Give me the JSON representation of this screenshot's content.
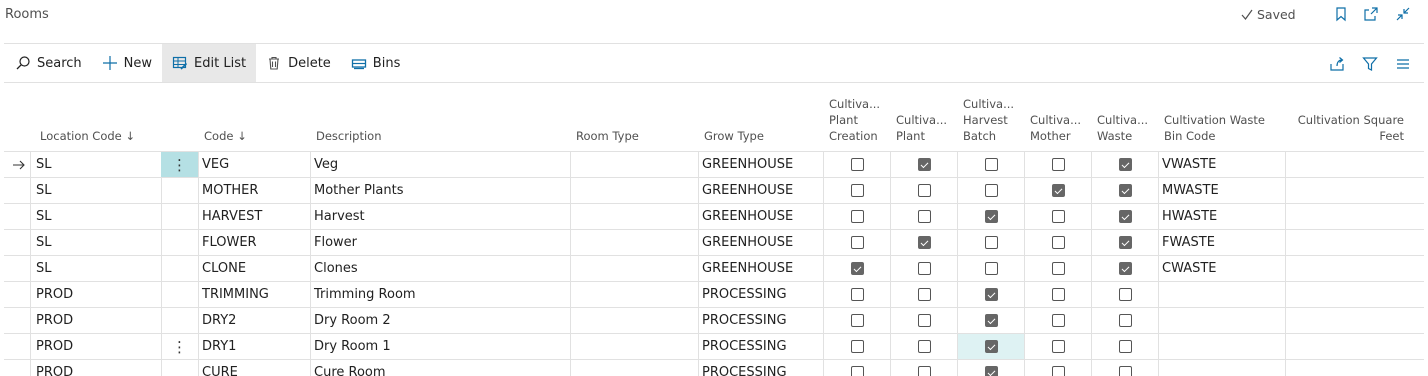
{
  "page": {
    "title": "Rooms",
    "saved_label": "Saved"
  },
  "toolbar": {
    "search": "Search",
    "new": "New",
    "edit_list": "Edit List",
    "delete": "Delete",
    "bins": "Bins"
  },
  "columns": {
    "location_code": "Location Code ↓",
    "code": "Code ↓",
    "description": "Description",
    "room_type": "Room Type",
    "grow_type": "Grow Type",
    "plant_creation": "Cultiva... Plant Creation",
    "plant": "Cultiva... Plant",
    "harvest_batch": "Cultiva... Harvest Batch",
    "mother": "Cultiva... Mother",
    "waste": "Cultiva... Waste",
    "waste_bin_code": "Cultivation Waste Bin Code",
    "square_feet": "Cultivation Square Feet"
  },
  "rows": [
    {
      "location": "SL",
      "code": "VEG",
      "description": "Veg",
      "room_type": "",
      "grow_type": "GREENHOUSE",
      "plant_creation": false,
      "plant": true,
      "harvest_batch": false,
      "mother": false,
      "waste": true,
      "waste_bin": "VWASTE",
      "square_feet": ""
    },
    {
      "location": "SL",
      "code": "MOTHER",
      "description": "Mother Plants",
      "room_type": "",
      "grow_type": "GREENHOUSE",
      "plant_creation": false,
      "plant": false,
      "harvest_batch": false,
      "mother": true,
      "waste": true,
      "waste_bin": "MWASTE",
      "square_feet": ""
    },
    {
      "location": "SL",
      "code": "HARVEST",
      "description": "Harvest",
      "room_type": "",
      "grow_type": "GREENHOUSE",
      "plant_creation": false,
      "plant": false,
      "harvest_batch": true,
      "mother": false,
      "waste": true,
      "waste_bin": "HWASTE",
      "square_feet": ""
    },
    {
      "location": "SL",
      "code": "FLOWER",
      "description": "Flower",
      "room_type": "",
      "grow_type": "GREENHOUSE",
      "plant_creation": false,
      "plant": true,
      "harvest_batch": false,
      "mother": false,
      "waste": true,
      "waste_bin": "FWASTE",
      "square_feet": ""
    },
    {
      "location": "SL",
      "code": "CLONE",
      "description": "Clones",
      "room_type": "",
      "grow_type": "GREENHOUSE",
      "plant_creation": true,
      "plant": false,
      "harvest_batch": false,
      "mother": false,
      "waste": true,
      "waste_bin": "CWASTE",
      "square_feet": ""
    },
    {
      "location": "PROD",
      "code": "TRIMMING",
      "description": "Trimming Room",
      "room_type": "",
      "grow_type": "PROCESSING",
      "plant_creation": false,
      "plant": false,
      "harvest_batch": true,
      "mother": false,
      "waste": false,
      "waste_bin": "",
      "square_feet": ""
    },
    {
      "location": "PROD",
      "code": "DRY2",
      "description": "Dry Room 2",
      "room_type": "",
      "grow_type": "PROCESSING",
      "plant_creation": false,
      "plant": false,
      "harvest_batch": true,
      "mother": false,
      "waste": false,
      "waste_bin": "",
      "square_feet": ""
    },
    {
      "location": "PROD",
      "code": "DRY1",
      "description": "Dry Room 1",
      "room_type": "",
      "grow_type": "PROCESSING",
      "plant_creation": false,
      "plant": false,
      "harvest_batch": true,
      "mother": false,
      "waste": false,
      "waste_bin": "",
      "square_feet": ""
    },
    {
      "location": "PROD",
      "code": "CURE",
      "description": "Cure Room",
      "room_type": "",
      "grow_type": "PROCESSING",
      "plant_creation": false,
      "plant": false,
      "harvest_batch": true,
      "mother": false,
      "waste": false,
      "waste_bin": "",
      "square_feet": ""
    }
  ]
}
